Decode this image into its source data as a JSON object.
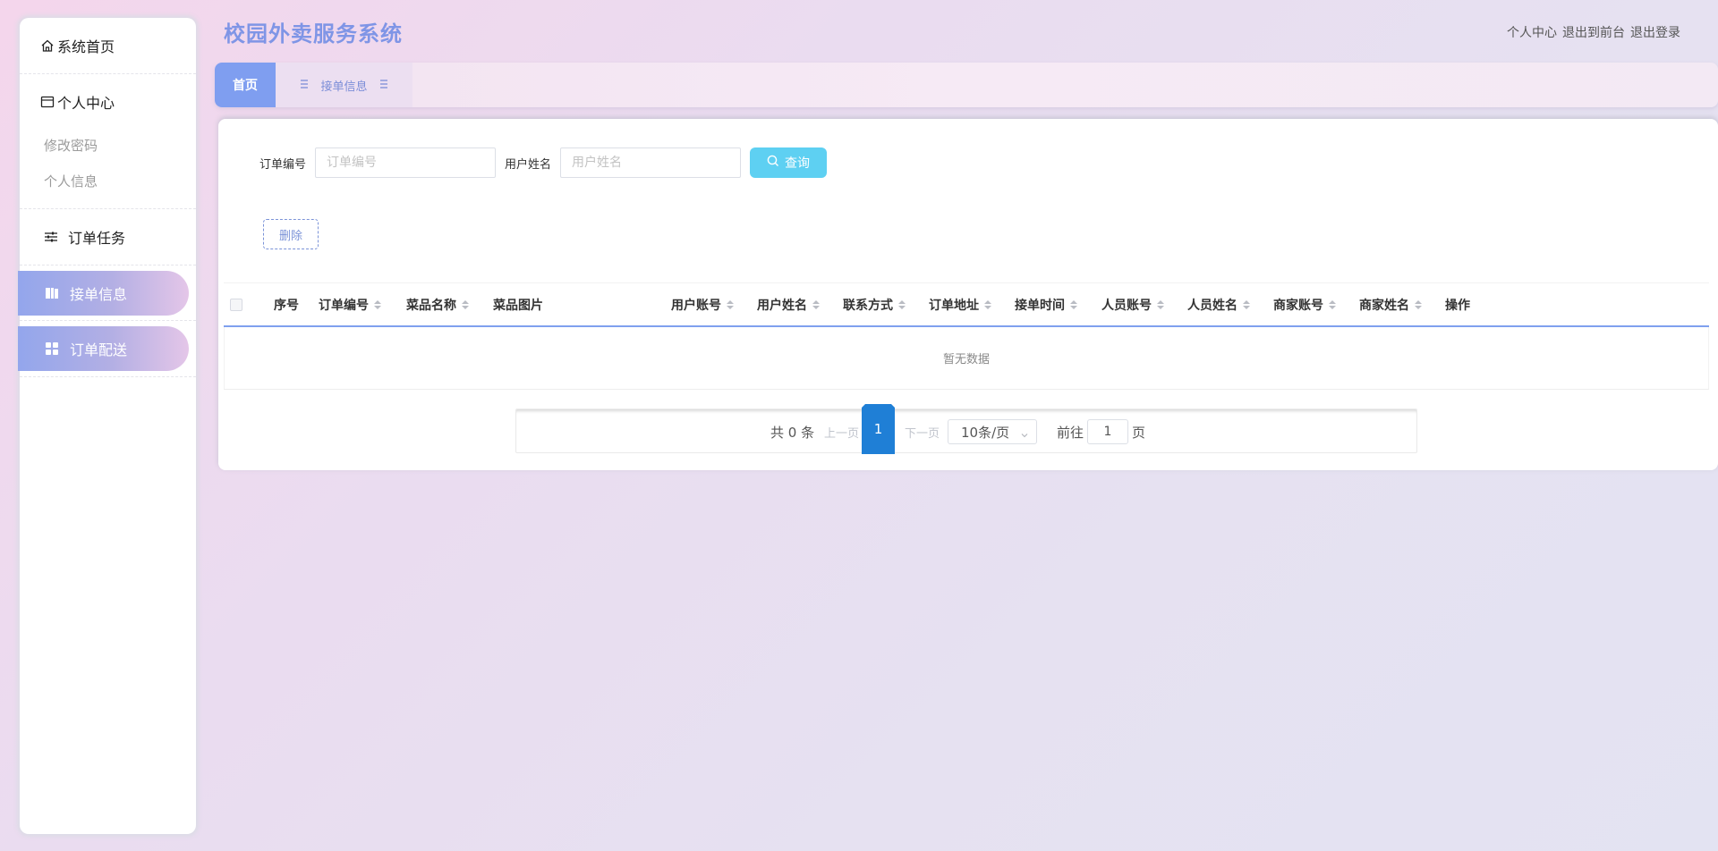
{
  "sidebar": {
    "home": "系统首页",
    "personal_center": "个人中心",
    "personal_sub": [
      "修改密码",
      "个人信息"
    ],
    "order_tasks": "订单任务",
    "receive_info": "接单信息",
    "order_delivery": "订单配送"
  },
  "header": {
    "title": "校园外卖服务系统",
    "links": [
      "个人中心",
      "退出到前台",
      "退出登录"
    ]
  },
  "tabs": [
    {
      "label": "首页",
      "active": true
    },
    {
      "label": "接单信息",
      "active": false
    }
  ],
  "search": {
    "order_no_label": "订单编号",
    "order_no_placeholder": "订单编号",
    "user_name_label": "用户姓名",
    "user_name_placeholder": "用户姓名",
    "query_button": "查询"
  },
  "actions": {
    "delete_button": "删除"
  },
  "table": {
    "columns": [
      "序号",
      "订单编号",
      "菜品名称",
      "菜品图片",
      "用户账号",
      "用户姓名",
      "联系方式",
      "订单地址",
      "接单时间",
      "人员账号",
      "人员姓名",
      "商家账号",
      "商家姓名",
      "操作"
    ],
    "empty_text": "暂无数据"
  },
  "pagination": {
    "total_text": "共 0 条",
    "prev": "上一页",
    "current_page": "1",
    "next": "下一页",
    "page_size": "10条/页",
    "goto_label": "前往",
    "goto_value": "1",
    "page_suffix": "页"
  },
  "colors": {
    "accent": "#7f9ef0",
    "title": "#7f95e6",
    "query_button": "#5ed0f2",
    "current_page": "#1f7fd6"
  }
}
